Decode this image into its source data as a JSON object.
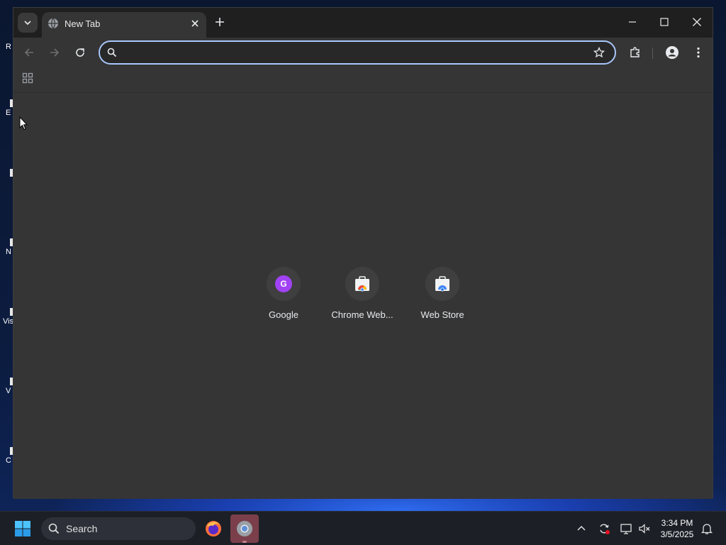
{
  "desktop": {
    "icon_labels": [
      "R",
      "E",
      "",
      "N",
      "Vis",
      "V",
      "C"
    ]
  },
  "tabstrip": {
    "tabs": [
      {
        "title": "New Tab"
      }
    ]
  },
  "omnibox": {
    "value": "",
    "placeholder": ""
  },
  "shortcuts": [
    {
      "label": "Google",
      "icon": "google-letter-icon",
      "letter": "G"
    },
    {
      "label": "Chrome Web...",
      "icon": "chrome-web-store-icon"
    },
    {
      "label": "Web Store",
      "icon": "web-store-icon"
    }
  ],
  "taskbar": {
    "search_label": "Search",
    "clock": {
      "time": "3:34 PM",
      "date": "3/5/2025"
    }
  },
  "colors": {
    "focus_ring": "#a8c7fa",
    "google_avatar": "#a142f4",
    "active_app": "#7a3f4a"
  }
}
